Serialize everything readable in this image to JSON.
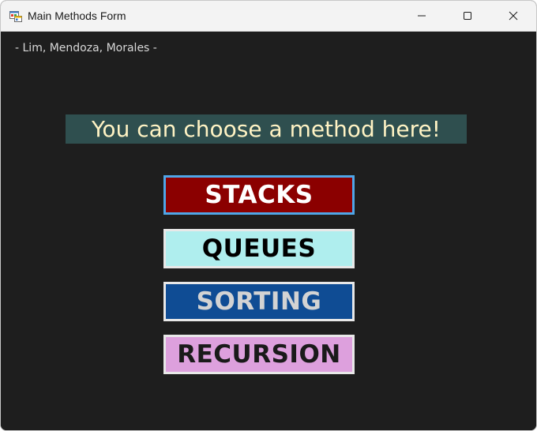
{
  "window": {
    "title": "Main Methods Form",
    "icon": "winforms-app-icon",
    "controls": {
      "minimize_icon": "minimize-icon",
      "maximize_icon": "maximize-icon",
      "close_icon": "close-icon"
    }
  },
  "form": {
    "authors": "- Lim, Mendoza, Morales -",
    "banner": "You can choose a method here!",
    "buttons": {
      "stacks": "STACKS",
      "queues": "QUEUES",
      "sorting": "SORTING",
      "recursion": "RECURSION"
    }
  },
  "colors": {
    "background": "#1e1e1e",
    "banner_bg": "#2f4f4f",
    "banner_text": "#fff3c4",
    "stacks_bg": "#8b0000",
    "queues_bg": "#afeeee",
    "sorting_bg": "#0f4c94",
    "recursion_bg": "#dda0dd",
    "focus_border": "#4fa6e8"
  }
}
